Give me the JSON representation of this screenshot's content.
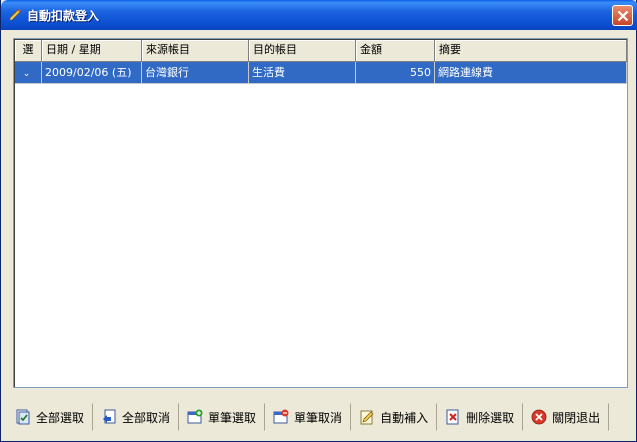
{
  "window": {
    "title": "自動扣款登入"
  },
  "table": {
    "columns": [
      "選",
      "日期 / 星期",
      "來源帳目",
      "目的帳目",
      "金額",
      "摘要"
    ],
    "rows": [
      {
        "selected": "⌄",
        "date": "2009/02/06 (五)",
        "source": "台灣銀行",
        "target": "生活費",
        "amount": "550",
        "memo": "網路連線費"
      }
    ]
  },
  "toolbar": {
    "select_all": "全部選取",
    "cancel_all": "全部取消",
    "select_one": "單筆選取",
    "cancel_one": "單筆取消",
    "auto_fill": "自動補入",
    "delete_selected": "刪除選取",
    "close_exit": "關閉退出"
  },
  "colors": {
    "selection": "#316ac5",
    "titlebar": "#0b4fd0",
    "background": "#ece9d8"
  }
}
